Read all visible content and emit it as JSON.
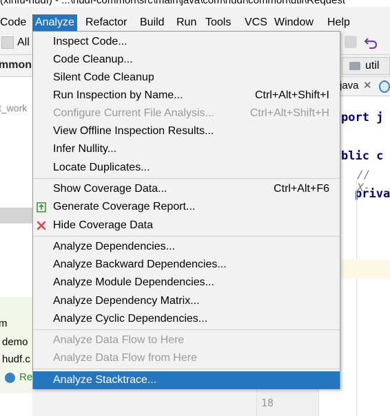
{
  "title": "(xinfu-hudf) - ...\\hudf-common\\src\\main\\java\\com\\hudf\\common\\util\\Request",
  "menubar": {
    "items": [
      {
        "label": "Code"
      },
      {
        "label": "Analyze"
      },
      {
        "label": "Refactor"
      },
      {
        "label": "Build"
      },
      {
        "label": "Run"
      },
      {
        "label": "Tools"
      },
      {
        "label": "VCS"
      },
      {
        "label": "Window"
      },
      {
        "label": "Help"
      }
    ]
  },
  "background": {
    "toolbar_all": "All",
    "nav_left": "mmon",
    "nav_util": "util",
    "left_texts": [
      "t_work",
      "m",
      "demo",
      "hudf.c",
      "Re"
    ],
    "tab": "java",
    "code": [
      "port j",
      "blic c",
      "// X-",
      "priva"
    ],
    "line_number": "18"
  },
  "menu": {
    "items": [
      {
        "label": "Inspect Code...",
        "mnemonic": "I"
      },
      {
        "label": "Code Cleanup...",
        "mnemonic": "C"
      },
      {
        "label": "Silent Code Cleanup"
      },
      {
        "label": "Run Inspection by Name...",
        "shortcut": "Ctrl+Alt+Shift+I"
      },
      {
        "label": "Configure Current File Analysis...",
        "shortcut": "Ctrl+Alt+Shift+H",
        "disabled": true
      },
      {
        "label": "View Offline Inspection Results..."
      },
      {
        "label": "Infer Nullity..."
      },
      {
        "label": "Locate Duplicates..."
      },
      {
        "label": "Show Coverage Data...",
        "shortcut": "Ctrl+Alt+F6"
      },
      {
        "label": "Generate Coverage Report...",
        "icon": "generate-report-icon"
      },
      {
        "label": "Hide Coverage Data",
        "icon": "close-icon"
      },
      {
        "label": "Analyze Dependencies..."
      },
      {
        "label": "Analyze Backward Dependencies..."
      },
      {
        "label": "Analyze Module Dependencies..."
      },
      {
        "label": "Analyze Dependency Matrix..."
      },
      {
        "label": "Analyze Cyclic Dependencies..."
      },
      {
        "label": "Analyze Data Flow to Here",
        "disabled": true
      },
      {
        "label": "Analyze Data Flow from Here",
        "disabled": true
      },
      {
        "label": "Analyze Stacktrace...",
        "selected": true
      }
    ]
  },
  "colors": {
    "accent": "#2675bf",
    "disabled_text": "#9a9a9a",
    "close_icon": "#e0443e",
    "report_icon": "#3a9a3a"
  }
}
